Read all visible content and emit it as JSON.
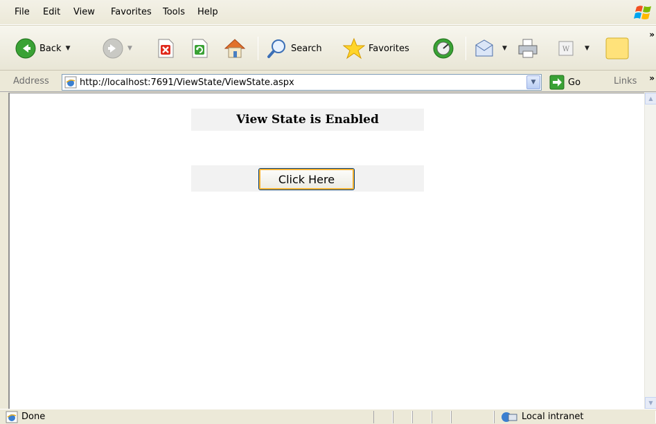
{
  "menu": {
    "items": [
      "File",
      "Edit",
      "View",
      "Favorites",
      "Tools",
      "Help"
    ]
  },
  "toolbar": {
    "back_label": "Back",
    "search_label": "Search",
    "favorites_label": "Favorites"
  },
  "address_bar": {
    "label": "Address",
    "url": "http://localhost:7691/ViewState/ViewState.aspx",
    "go_label": "Go",
    "links_label": "Links"
  },
  "page": {
    "heading": "View State is Enabled",
    "button_label": "Click Here"
  },
  "status_bar": {
    "status": "Done",
    "zone": "Local intranet"
  },
  "colors": {
    "chrome": "#ece9d8",
    "page_background": "#ffffff",
    "cell_background": "#f2f2f2",
    "button_focus": "#f8b331"
  }
}
